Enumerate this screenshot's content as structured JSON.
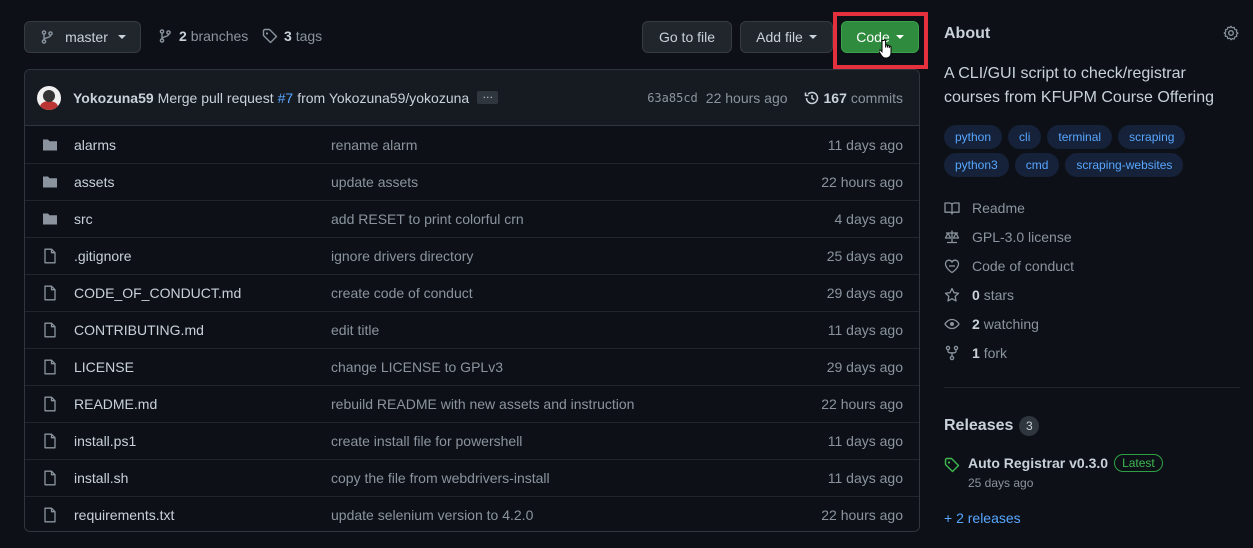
{
  "branch_button": {
    "label": "master"
  },
  "branches": {
    "count": "2",
    "label": "branches"
  },
  "tags": {
    "count": "3",
    "label": "tags"
  },
  "actions": {
    "go_to_file": "Go to file",
    "add_file": "Add file",
    "code": "Code"
  },
  "latest_commit": {
    "author": "Yokozuna59",
    "message_prefix": "Merge pull request",
    "pr": "#7",
    "message_suffix": "from Yokozuna59/yokozuna",
    "ellipsis": "…",
    "sha": "63a85cd",
    "time": "22 hours ago",
    "commits_count": "167",
    "commits_label": "commits"
  },
  "files": [
    {
      "type": "dir",
      "name": "alarms",
      "message": "rename alarm",
      "date": "11 days ago"
    },
    {
      "type": "dir",
      "name": "assets",
      "message": "update assets",
      "date": "22 hours ago"
    },
    {
      "type": "dir",
      "name": "src",
      "message": "add RESET to print colorful crn",
      "date": "4 days ago"
    },
    {
      "type": "file",
      "name": ".gitignore",
      "message": "ignore drivers directory",
      "date": "25 days ago"
    },
    {
      "type": "file",
      "name": "CODE_OF_CONDUCT.md",
      "message": "create code of conduct",
      "date": "29 days ago"
    },
    {
      "type": "file",
      "name": "CONTRIBUTING.md",
      "message": "edit title",
      "date": "11 days ago"
    },
    {
      "type": "file",
      "name": "LICENSE",
      "message": "change LICENSE to GPLv3",
      "date": "29 days ago"
    },
    {
      "type": "file",
      "name": "README.md",
      "message": "rebuild README with new assets and instruction",
      "date": "22 hours ago"
    },
    {
      "type": "file",
      "name": "install.ps1",
      "message": "create install file for powershell",
      "date": "11 days ago"
    },
    {
      "type": "file",
      "name": "install.sh",
      "message": "copy the file from webdrivers-install",
      "date": "11 days ago"
    },
    {
      "type": "file",
      "name": "requirements.txt",
      "message": "update selenium version to 4.2.0",
      "date": "22 hours ago"
    }
  ],
  "about": {
    "title": "About",
    "description": "A CLI/GUI script to check/registrar courses from KFUPM Course Offering",
    "topics": [
      "python",
      "cli",
      "terminal",
      "scraping",
      "python3",
      "cmd",
      "scraping-websites"
    ],
    "readme": "Readme",
    "license": "GPL-3.0 license",
    "conduct": "Code of conduct",
    "stars_count": "0",
    "stars_label": "stars",
    "watching_count": "2",
    "watching_label": "watching",
    "fork_count": "1",
    "fork_label": "fork"
  },
  "releases": {
    "title": "Releases",
    "count": "3",
    "latest_name": "Auto Registrar v0.3.0",
    "latest_badge": "Latest",
    "latest_date": "25 days ago",
    "more": "+ 2 releases"
  },
  "colors": {
    "accent_green": "#2f8b3d",
    "highlight_red": "#e5303e",
    "link_blue": "#58a6ff"
  }
}
